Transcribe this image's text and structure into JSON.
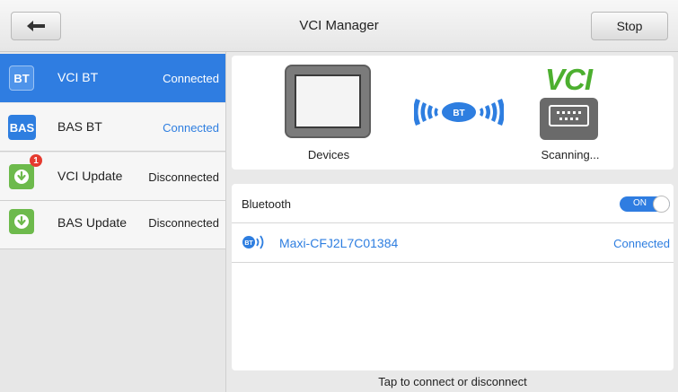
{
  "header": {
    "title": "VCI Manager",
    "back_icon": "arrow-left-icon",
    "stop_label": "Stop"
  },
  "sidebar": {
    "items": [
      {
        "icon_text": "BT",
        "label": "VCI BT",
        "status": "Connected",
        "active": true
      },
      {
        "icon_text": "BAS",
        "label": "BAS BT",
        "status": "Connected",
        "active": false
      },
      {
        "icon_text": "",
        "icon": "download-icon",
        "badge": "1",
        "label": "VCI Update",
        "status": "Disconnected",
        "active": false
      },
      {
        "icon_text": "",
        "icon": "download-icon",
        "label": "BAS Update",
        "status": "Disconnected",
        "active": false
      }
    ]
  },
  "connection_panel": {
    "devices_label": "Devices",
    "signal_icon_text": "BT",
    "vci_logo": "VCI",
    "scanning_label": "Scanning..."
  },
  "bluetooth": {
    "label": "Bluetooth",
    "toggle_text": "ON",
    "toggle_on": true
  },
  "device_list": [
    {
      "icon": "bt-signal-icon",
      "icon_text": "BT",
      "name": "Maxi-CFJ2L7C01384",
      "status": "Connected"
    }
  ],
  "footer": {
    "hint": "Tap to connect or disconnect"
  },
  "colors": {
    "accent": "#2f7de1",
    "update_green": "#6dba4c",
    "badge_red": "#e53a2f",
    "vci_green": "#4caf2f"
  }
}
